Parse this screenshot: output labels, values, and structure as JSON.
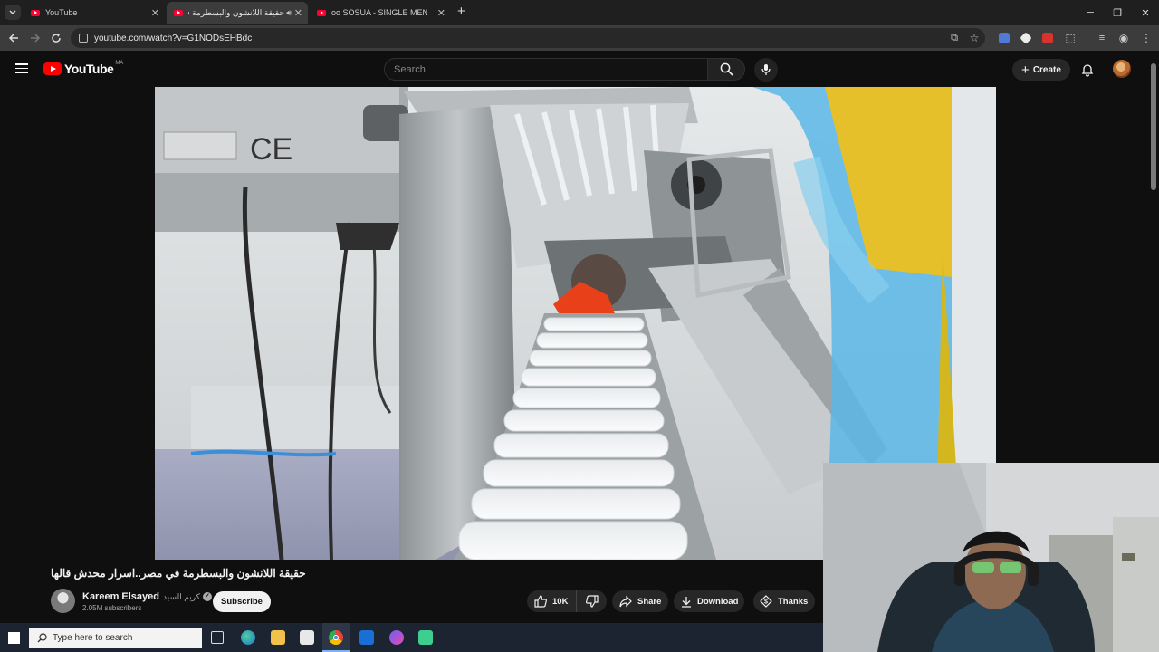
{
  "browser": {
    "tabs": [
      {
        "label": "YouTube",
        "active": false
      },
      {
        "label": "حقيقة اللانشون والبسطرمة ف",
        "active": true
      },
      {
        "label": "oo SOSUA - SINGLE MEN'S PAR",
        "active": false
      }
    ],
    "new_tab_label": "+",
    "window_controls": [
      "minimize",
      "restore",
      "close"
    ],
    "url": "youtube.com/watch?v=G1NODsEHBdc"
  },
  "youtube": {
    "logo_text": "YouTube",
    "country_code": "MA",
    "search_placeholder": "Search",
    "create_label": "Create"
  },
  "video": {
    "title": "حقيقة اللانشون والبسطرمة في مصر..اسرار محدش قالها",
    "channel_name": "Kareem Elsayed",
    "channel_name_ar": "كريم السيد",
    "subscribers": "2.05M subscribers",
    "subscribe_label": "Subscribe",
    "like_count": "10K",
    "share_label": "Share",
    "download_label": "Download",
    "thanks_label": "Thanks",
    "frame_text": {
      "ce_mark": "CE"
    }
  },
  "taskbar": {
    "search_placeholder": "Type here to search"
  },
  "colors": {
    "youtube_red": "#ff0000",
    "background": "#0f0f0f",
    "pill": "#272727"
  }
}
